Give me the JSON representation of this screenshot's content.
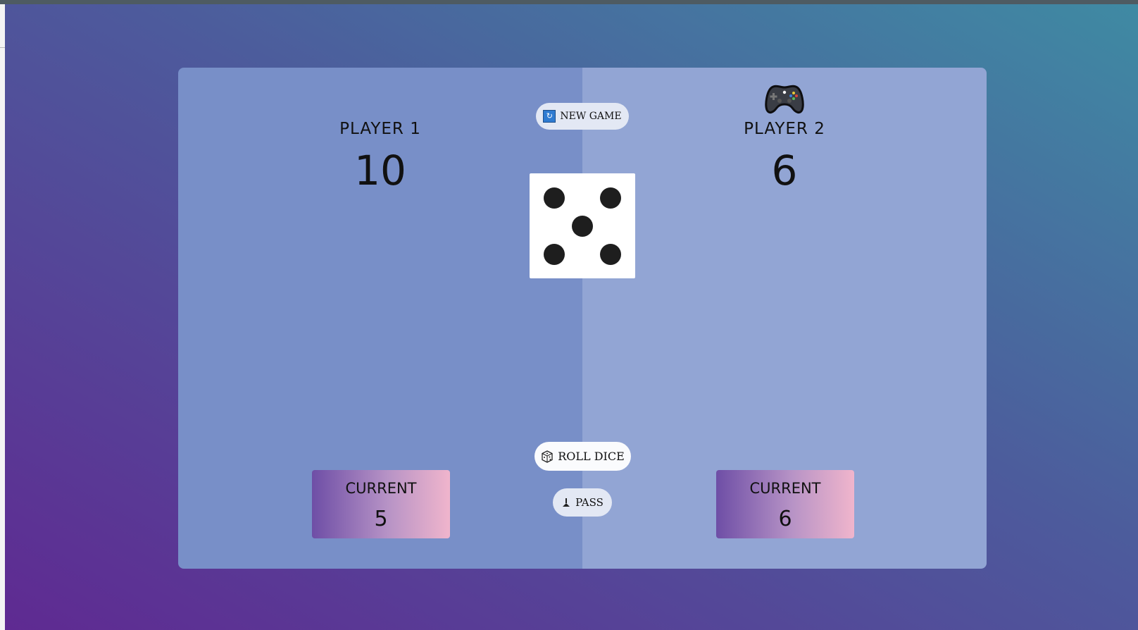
{
  "player1": {
    "name": "PLAYER 1",
    "score": "10",
    "current_label": "CURRENT",
    "current": "5",
    "active": false
  },
  "player2": {
    "name": "PLAYER 2",
    "score": "6",
    "current_label": "CURRENT",
    "current": "6",
    "active": true,
    "active_icon": "game-controller-icon"
  },
  "controls": {
    "new_game": "NEW GAME",
    "roll_dice": "ROLL DICE",
    "pass": "PASS"
  },
  "dice": {
    "value": 5
  },
  "colors": {
    "panel_left": "#788fc8",
    "panel_right": "#92a5d4",
    "current_gradient_start": "#6e4ea6",
    "current_gradient_end": "#f0b5cc",
    "pip": "#1e1e1e"
  }
}
